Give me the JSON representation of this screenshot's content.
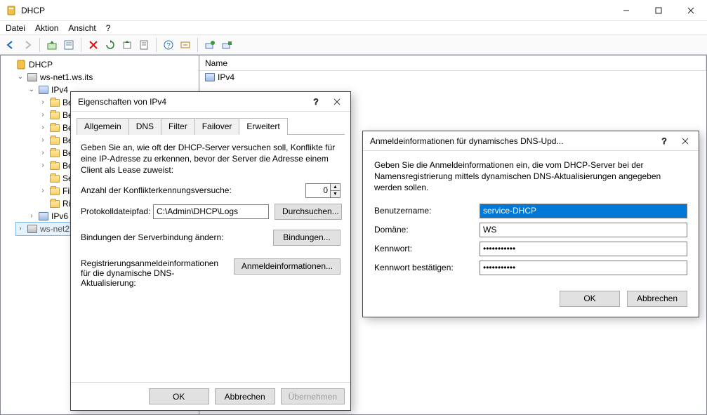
{
  "window": {
    "title": "DHCP",
    "menus": [
      "Datei",
      "Aktion",
      "Ansicht",
      "?"
    ],
    "win_controls": {
      "minimize": "–",
      "maximize": "▢",
      "close": "✕"
    }
  },
  "tree": {
    "root": "DHCP",
    "server1": "ws-net1.ws.its",
    "ipv4": "IPv4",
    "be": "Be",
    "fil": "Fil",
    "ric": "Ri",
    "se": "Se",
    "ipv6": "IPv6",
    "server2": "ws-net2.w"
  },
  "list": {
    "name_header": "Name",
    "row_ipv4": "IPv4"
  },
  "props_dialog": {
    "title": "Eigenschaften von IPv4",
    "tabs": [
      "Allgemein",
      "DNS",
      "Filter",
      "Failover",
      "Erweitert"
    ],
    "active_tab": 4,
    "intro": "Geben Sie an, wie oft der DHCP-Server versuchen soll, Konflikte für eine IP-Adresse zu erkennen, bevor der Server die Adresse einem Client als Lease zuweist:",
    "conflict_label": "Anzahl der Konflikterkennungsversuche:",
    "conflict_value": "0",
    "logpath_label": "Protokolldateipfad:",
    "logpath_value": "C:\\Admin\\DHCP\\Logs",
    "browse_btn": "Durchsuchen...",
    "bindings_label": "Bindungen der Serverbindung ändern:",
    "bindings_btn": "Bindungen...",
    "creds_label": "Registrierungsanmeldeinformationen für die dynamische DNS-Aktualisierung:",
    "creds_btn": "Anmeldeinformationen...",
    "ok": "OK",
    "cancel": "Abbrechen",
    "apply": "Übernehmen"
  },
  "creds_dialog": {
    "title": "Anmeldeinformationen für dynamisches DNS-Upd...",
    "intro": "Geben Sie die Anmeldeinformationen ein, die vom DHCP-Server bei der Namensregistrierung mittels dynamischen DNS-Aktualisierungen angegeben werden sollen.",
    "user_label": "Benutzername:",
    "user_value": "service-DHCP",
    "domain_label": "Domäne:",
    "domain_value": "WS",
    "pw_label": "Kennwort:",
    "pw_value": "●●●●●●●●●●●",
    "pw2_label": "Kennwort bestätigen:",
    "pw2_value": "●●●●●●●●●●●",
    "ok": "OK",
    "cancel": "Abbrechen"
  }
}
